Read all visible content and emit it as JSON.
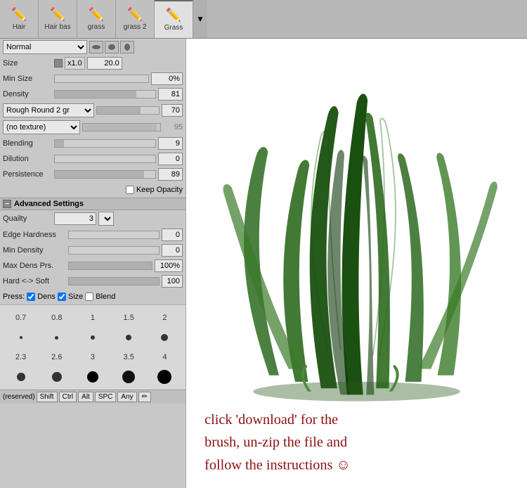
{
  "tabs": [
    {
      "label": "Hair",
      "icon": "✏️",
      "active": false
    },
    {
      "label": "Hair bas",
      "icon": "✏️",
      "active": false
    },
    {
      "label": "grass",
      "icon": "✏️",
      "active": false
    },
    {
      "label": "grass 2",
      "icon": "✏️",
      "active": false
    },
    {
      "label": "Grass",
      "icon": "✏️",
      "active": true
    }
  ],
  "mode": "Normal",
  "size": {
    "multiplier": "x1.0",
    "value": "20.0"
  },
  "min_size": {
    "value": "0%"
  },
  "density": {
    "value": "81"
  },
  "brush_shape": {
    "label": "Rough Round 2 gr",
    "value": "70"
  },
  "texture": {
    "label": "(no texture)",
    "value": "95"
  },
  "blending": {
    "value": "9"
  },
  "dilution": {
    "value": "0"
  },
  "persistence": {
    "value": "89"
  },
  "keep_opacity": false,
  "advanced_settings": "Advanced Settings",
  "quality": {
    "value": "3"
  },
  "edge_hardness": {
    "value": "0"
  },
  "min_density": {
    "value": "0"
  },
  "max_dens_prs": {
    "value": "100%"
  },
  "hard_soft": {
    "label": "Hard <-> Soft",
    "value": "100"
  },
  "press_labels": [
    "Press:",
    "Dens",
    "Size",
    "Blend"
  ],
  "dot_rows": [
    [
      {
        "label": "0.7",
        "size": 4
      },
      {
        "label": "0.8",
        "size": 5
      },
      {
        "label": "1",
        "size": 6
      },
      {
        "label": "1.5",
        "size": 8
      },
      {
        "label": "2",
        "size": 10
      }
    ],
    [
      {
        "label": "·",
        "size": 3
      },
      {
        "label": "·",
        "size": 3
      },
      {
        "label": "·",
        "size": 4
      },
      {
        "label": "·",
        "size": 4
      },
      {
        "label": "·",
        "size": 5
      }
    ],
    [
      {
        "label": "2.3",
        "size": 12
      },
      {
        "label": "2.6",
        "size": 14
      },
      {
        "label": "3",
        "size": 16
      },
      {
        "label": "3.5",
        "size": 18
      },
      {
        "label": "4",
        "size": 20
      }
    ],
    [
      {
        "label": "·",
        "size": 4
      },
      {
        "label": "·",
        "size": 4
      },
      {
        "label": "●",
        "size": 6
      },
      {
        "label": "●",
        "size": 7
      },
      {
        "label": "●",
        "size": 8
      }
    ]
  ],
  "keyboard_bar": {
    "reserved": "(reserved)",
    "keys": [
      "Shift",
      "Ctrl",
      "Alt",
      "SPC",
      "Any"
    ]
  },
  "handwritten": {
    "line1": "click 'download' for the",
    "line2": "brush, un-zip the file and",
    "line3": "follow the instructions ☺"
  }
}
